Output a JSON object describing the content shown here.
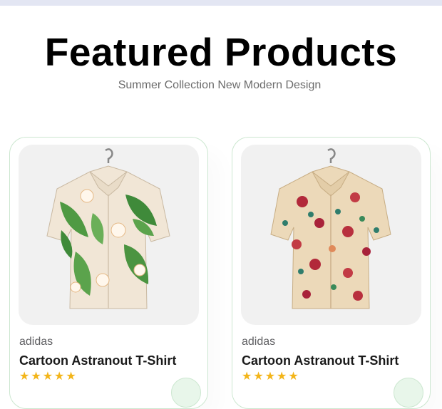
{
  "section": {
    "title": "Featured Products",
    "subtitle": "Summer Collection New Modern Design"
  },
  "products": [
    {
      "image_icon": "tropical-leaf-print-shirt",
      "brand": "adidas",
      "name": "Cartoon Astranout T-Shirt",
      "rating_stars": 5,
      "stars": "★★★★★"
    },
    {
      "image_icon": "red-floral-print-shirt",
      "brand": "adidas",
      "name": "Cartoon Astranout T-Shirt",
      "rating_stars": 5,
      "stars": "★★★★★"
    }
  ],
  "colors": {
    "accent_green": "#cce7d0",
    "cart_bg": "#e8f6ea",
    "star": "#f3b519"
  }
}
